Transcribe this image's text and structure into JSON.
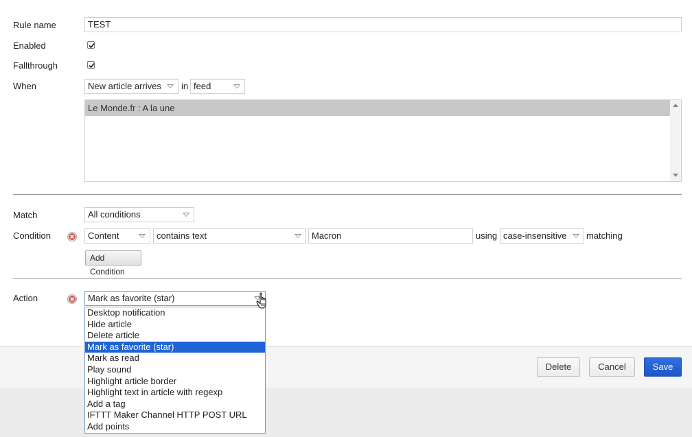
{
  "form": {
    "rule_name_label": "Rule name",
    "rule_name_value": "TEST",
    "enabled_label": "Enabled",
    "enabled_checked": true,
    "fallthrough_label": "Fallthrough",
    "fallthrough_checked": true,
    "when_label": "When",
    "when_event": "New article arrives",
    "in_label": "in",
    "when_scope": "feed",
    "feeds": [
      "Le Monde.fr : A la une"
    ],
    "match_label": "Match",
    "match_value": "All conditions",
    "condition_label": "Condition",
    "condition": {
      "field": "Content",
      "operator": "contains text",
      "value": "Macron",
      "using_label": "using",
      "case": "case-insensitive",
      "matching_label": "matching"
    },
    "add_condition_label": "Add Condition",
    "action_label": "Action",
    "action_value": "Mark as favorite (star)",
    "action_options": [
      "Desktop notification",
      "Hide article",
      "Delete article",
      "Mark as favorite (star)",
      "Mark as read",
      "Play sound",
      "Highlight article border",
      "Highlight text in article with regexp",
      "Add a tag",
      "IFTTT Maker Channel HTTP POST URL",
      "Add points"
    ],
    "action_selected_index": 3
  },
  "footer": {
    "delete_label": "Delete",
    "cancel_label": "Cancel",
    "save_label": "Save"
  },
  "colors": {
    "accent": "#1e64d6",
    "selected_feed_bg": "#c8c8c8",
    "remove_icon": "#d9534f"
  },
  "icons": {
    "remove": "remove-circle-icon",
    "dropdown": "chevron-down-icon",
    "check": "checkmark-icon",
    "cursor": "hand-pointer-icon"
  }
}
